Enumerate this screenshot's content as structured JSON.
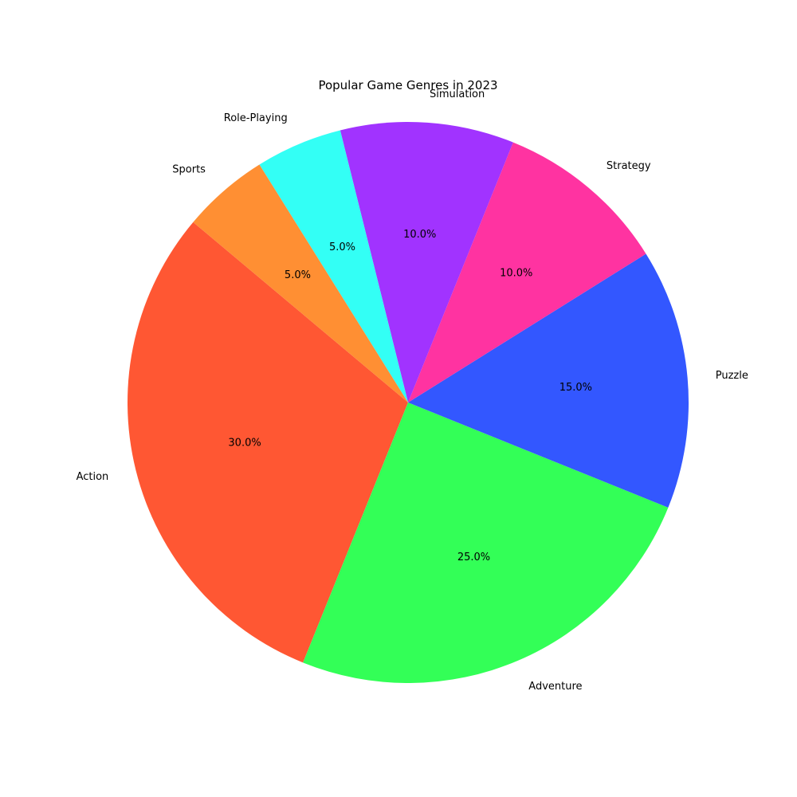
{
  "chart_data": {
    "type": "pie",
    "title": "Popular Game Genres in 2023",
    "start_angle_deg": 140,
    "direction": "counterclockwise",
    "slices": [
      {
        "label": "Action",
        "value": 30.0,
        "pct_label": "30.0%",
        "color": "#FF5733"
      },
      {
        "label": "Adventure",
        "value": 25.0,
        "pct_label": "25.0%",
        "color": "#33FF57"
      },
      {
        "label": "Puzzle",
        "value": 15.0,
        "pct_label": "15.0%",
        "color": "#3357FF"
      },
      {
        "label": "Strategy",
        "value": 10.0,
        "pct_label": "10.0%",
        "color": "#FF33A1"
      },
      {
        "label": "Simulation",
        "value": 10.0,
        "pct_label": "10.0%",
        "color": "#A133FF"
      },
      {
        "label": "Role-Playing",
        "value": 5.0,
        "pct_label": "5.0%",
        "color": "#33FFF5"
      },
      {
        "label": "Sports",
        "value": 5.0,
        "pct_label": "5.0%",
        "color": "#FF8F33"
      }
    ]
  }
}
